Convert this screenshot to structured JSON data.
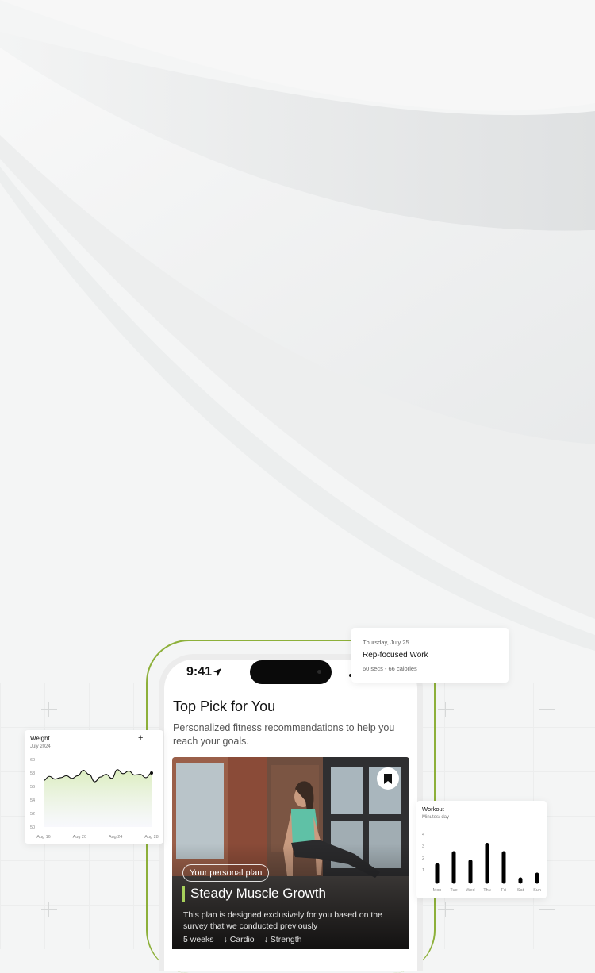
{
  "status_bar": {
    "time": "9:41"
  },
  "recommendations": {
    "title": "Top Pick for You",
    "subtitle": "Personalized fitness recommendations to help you reach your goals."
  },
  "plan_card": {
    "badge": "Your personal plan",
    "title": "Steady Muscle Growth",
    "description": "This plan is designed exclusively for you based on the survey that we conducted previously",
    "meta": [
      "5 weeks",
      "↓ Cardio",
      "↓ Strength"
    ]
  },
  "notification": {
    "date": "Thursday, July 25",
    "title": "Rep-focused Work",
    "detail": "60 secs - 66 calories"
  },
  "weight_widget": {
    "title": "Weight",
    "subtitle": "July 2024",
    "add_label": "+"
  },
  "workout_widget": {
    "title": "Workout",
    "subtitle": "Minutes/ day"
  },
  "colors": {
    "accent": "#8db03a",
    "accent_light": "#a7d15b"
  },
  "icons": [
    "location-arrow-icon",
    "bookmark-icon",
    "plus-icon"
  ],
  "chart_data": [
    {
      "type": "area",
      "title": "Weight",
      "subtitle": "July 2024",
      "x_ticks": [
        "Aug 16",
        "Aug 20",
        "Aug 24",
        "Aug 28"
      ],
      "y_ticks": [
        50,
        52,
        54,
        56,
        58,
        60
      ],
      "ylim": [
        50,
        60
      ],
      "values": [
        56.9,
        57.5,
        57.1,
        57.3,
        57.6,
        57.2,
        57.6,
        58.4,
        57.8,
        56.7,
        57.4,
        57.8,
        57.2,
        58.5,
        57.9,
        58.3,
        57.7,
        57.8,
        57.3,
        58
      ]
    },
    {
      "type": "bar",
      "title": "Workout",
      "subtitle": "Minutes/ day",
      "categories": [
        "Mon",
        "Tue",
        "Wed",
        "Thu",
        "Fri",
        "Sat",
        "Sun"
      ],
      "values": [
        1.4,
        2.4,
        1.7,
        3.1,
        2.4,
        0.2,
        0.6
      ],
      "y_ticks": [
        1,
        2,
        3,
        4
      ],
      "ylim": [
        0,
        4
      ]
    }
  ]
}
